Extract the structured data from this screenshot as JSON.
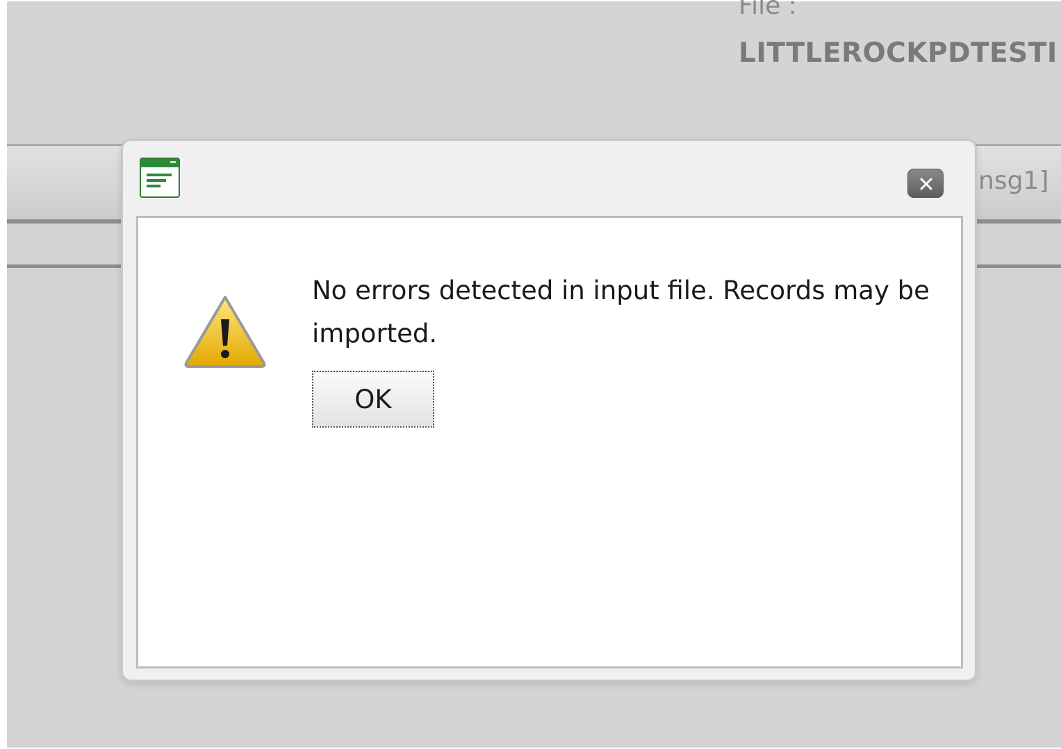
{
  "background": {
    "file_label": "File :",
    "file_name": "LITTLEROCKPDTESTI",
    "partial_message_ref": "nsg1]"
  },
  "dialog": {
    "app_icon": "window-list-icon",
    "close_icon": "close-x-icon",
    "warning_icon": "warning-triangle-icon",
    "message": "No errors detected in input file. Records may be imported.",
    "ok_label": "OK"
  },
  "colors": {
    "app_icon_accent": "#2e8b3a",
    "warning_fill": "#f5c400",
    "close_button": "#6e6e6e"
  }
}
